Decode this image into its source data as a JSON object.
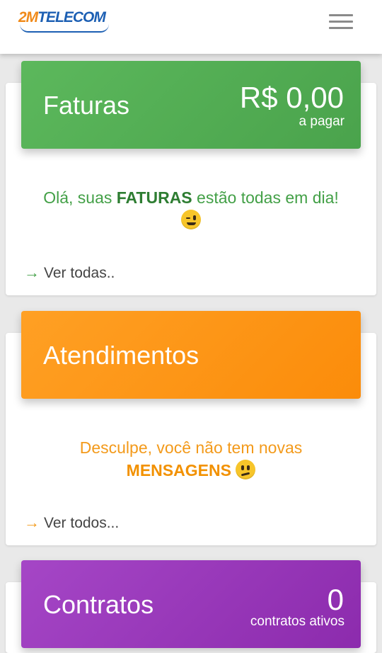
{
  "header": {
    "logo_text_a": "2M",
    "logo_text_b": "TELECOM",
    "menu_icon": "hamburger-menu-icon"
  },
  "faturas": {
    "title": "Faturas",
    "amount": "R$ 0,00",
    "amount_caption": "a pagar",
    "message_prefix": "Olá, suas ",
    "message_bold": "FATURAS",
    "message_suffix": " estão todas em dia!",
    "emoji": "wink-emoji-icon",
    "link_label": "Ver todas..",
    "accent": "#4caf50",
    "text_color": "#43a047"
  },
  "atendimentos": {
    "title": "Atendimentos",
    "message_line1": "Desculpe, você não tem novas",
    "message_bold": "MENSAGENS",
    "emoji": "sad-emoji-icon",
    "link_label": "Ver todos...",
    "accent": "#fb8c00",
    "text_color": "#f39a1b"
  },
  "contratos": {
    "title": "Contratos",
    "count": "0",
    "count_caption": "contratos ativos",
    "accent": "#9c27b0"
  }
}
